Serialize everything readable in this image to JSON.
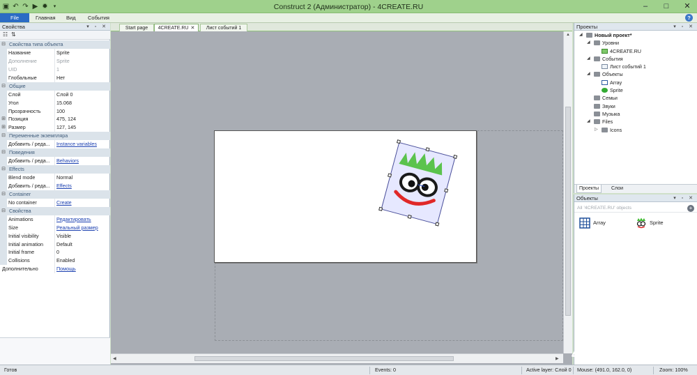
{
  "titlebar": {
    "title": "Construct 2 (Администратор) - 4CREATE.RU",
    "quick_icons": [
      "save-icon",
      "undo-icon",
      "redo-icon",
      "play-icon",
      "debug-icon",
      "dropdown-icon"
    ],
    "minimize": "–",
    "maximize": "□",
    "close": "✕"
  },
  "menu": {
    "file": "File",
    "home": "Главная",
    "view": "Вид",
    "events": "События",
    "help": "?"
  },
  "properties": {
    "title": "Свойства",
    "rows": [
      {
        "type": "section",
        "key": "Свойства типа объекта"
      },
      {
        "type": "prop",
        "key": "Название",
        "value": "Sprite"
      },
      {
        "type": "prop",
        "key": "Дополнение",
        "value": "Sprite",
        "dim": true
      },
      {
        "type": "prop",
        "key": "UID",
        "value": "1",
        "dim": true
      },
      {
        "type": "prop",
        "key": "Глобальные",
        "value": "Нет"
      },
      {
        "type": "section",
        "key": "Общие"
      },
      {
        "type": "prop",
        "key": "Слой",
        "value": "Слой 0"
      },
      {
        "type": "prop",
        "key": "Угол",
        "value": "15.068"
      },
      {
        "type": "prop",
        "key": "Прозрачность",
        "value": "100"
      },
      {
        "type": "prop",
        "key": "Позиция",
        "value": "475, 124",
        "expand": "+"
      },
      {
        "type": "prop",
        "key": "Размер",
        "value": "127, 145",
        "expand": "+"
      },
      {
        "type": "section",
        "key": "Переменные экземпляра"
      },
      {
        "type": "prop",
        "key": "Добавить / реда...",
        "value": "Instance variables",
        "link": true
      },
      {
        "type": "section",
        "key": "Поведения"
      },
      {
        "type": "prop",
        "key": "Добавить / реда...",
        "value": "Behaviors",
        "link": true
      },
      {
        "type": "section",
        "key": "Effects"
      },
      {
        "type": "prop",
        "key": "Blend mode",
        "value": "Normal"
      },
      {
        "type": "prop",
        "key": "Добавить / реда...",
        "value": "Effects",
        "link": true
      },
      {
        "type": "section",
        "key": "Container"
      },
      {
        "type": "prop",
        "key": "No container",
        "value": "Create",
        "link": true
      },
      {
        "type": "section",
        "key": "Свойства"
      },
      {
        "type": "prop",
        "key": "Animations",
        "value": "Редактировать",
        "link": true
      },
      {
        "type": "prop",
        "key": "Size",
        "value": "Реальный размер",
        "link": true
      },
      {
        "type": "prop",
        "key": "Initial visibility",
        "value": "Visible"
      },
      {
        "type": "prop",
        "key": "Initial animation",
        "value": "Default"
      },
      {
        "type": "prop",
        "key": "Initial frame",
        "value": "0"
      },
      {
        "type": "prop",
        "key": "Collisions",
        "value": "Enabled"
      },
      {
        "type": "prop",
        "key": "Дополнительно",
        "value": "Помощь",
        "link": true,
        "full": true
      }
    ]
  },
  "tabs": [
    {
      "label": "Start page",
      "closable": false,
      "active": false
    },
    {
      "label": "4CREATE.RU",
      "closable": true,
      "active": true
    },
    {
      "label": "Лист событий 1",
      "closable": false,
      "active": false
    }
  ],
  "projects": {
    "title": "Проекты",
    "tree": [
      {
        "label": "Новый проект*",
        "level": 0,
        "icon": "project-icon",
        "twisty": "◢",
        "bold": true
      },
      {
        "label": "Уровни",
        "level": 1,
        "icon": "folder-icon",
        "twisty": "◢"
      },
      {
        "label": "4CREATE.RU",
        "level": 2,
        "icon": "layout-icon"
      },
      {
        "label": "События",
        "level": 1,
        "icon": "folder-icon",
        "twisty": "◢"
      },
      {
        "label": "Лист событий 1",
        "level": 2,
        "icon": "event-sheet-icon"
      },
      {
        "label": "Объекты",
        "level": 1,
        "icon": "folder-icon",
        "twisty": "◢"
      },
      {
        "label": "Array",
        "level": 2,
        "icon": "array-icon"
      },
      {
        "label": "Sprite",
        "level": 2,
        "icon": "sprite-icon"
      },
      {
        "label": "Семьи",
        "level": 1,
        "icon": "folder-icon"
      },
      {
        "label": "Звуки",
        "level": 1,
        "icon": "folder-icon"
      },
      {
        "label": "Музыка",
        "level": 1,
        "icon": "folder-icon"
      },
      {
        "label": "Files",
        "level": 1,
        "icon": "folder-icon",
        "twisty": "◢"
      },
      {
        "label": "Icons",
        "level": 2,
        "icon": "folder-icon",
        "twisty": "▷"
      }
    ],
    "bottom_tabs": [
      "Проекты",
      "Слои"
    ]
  },
  "objects": {
    "title": "Объекты",
    "filter": "All '4CREATE.RU' objects",
    "add": "+",
    "items": [
      {
        "label": "Array",
        "icon": "array-icon"
      },
      {
        "label": "Sprite",
        "icon": "sprite-icon"
      }
    ]
  },
  "watermark": {
    "text": "4CREATE.RU"
  },
  "status": {
    "ready": "Готов",
    "events": "Events: 0",
    "active_layer": "Active layer: Слой 0",
    "mouse": "Mouse: (491.0, 162.0, 0)",
    "zoom": "Zoom: 100%"
  },
  "colors": {
    "titlebar": "#9fd18c",
    "file_menu": "#2b6cc4",
    "layout_bg": "#a9adb4",
    "link": "#1a3fb0"
  }
}
